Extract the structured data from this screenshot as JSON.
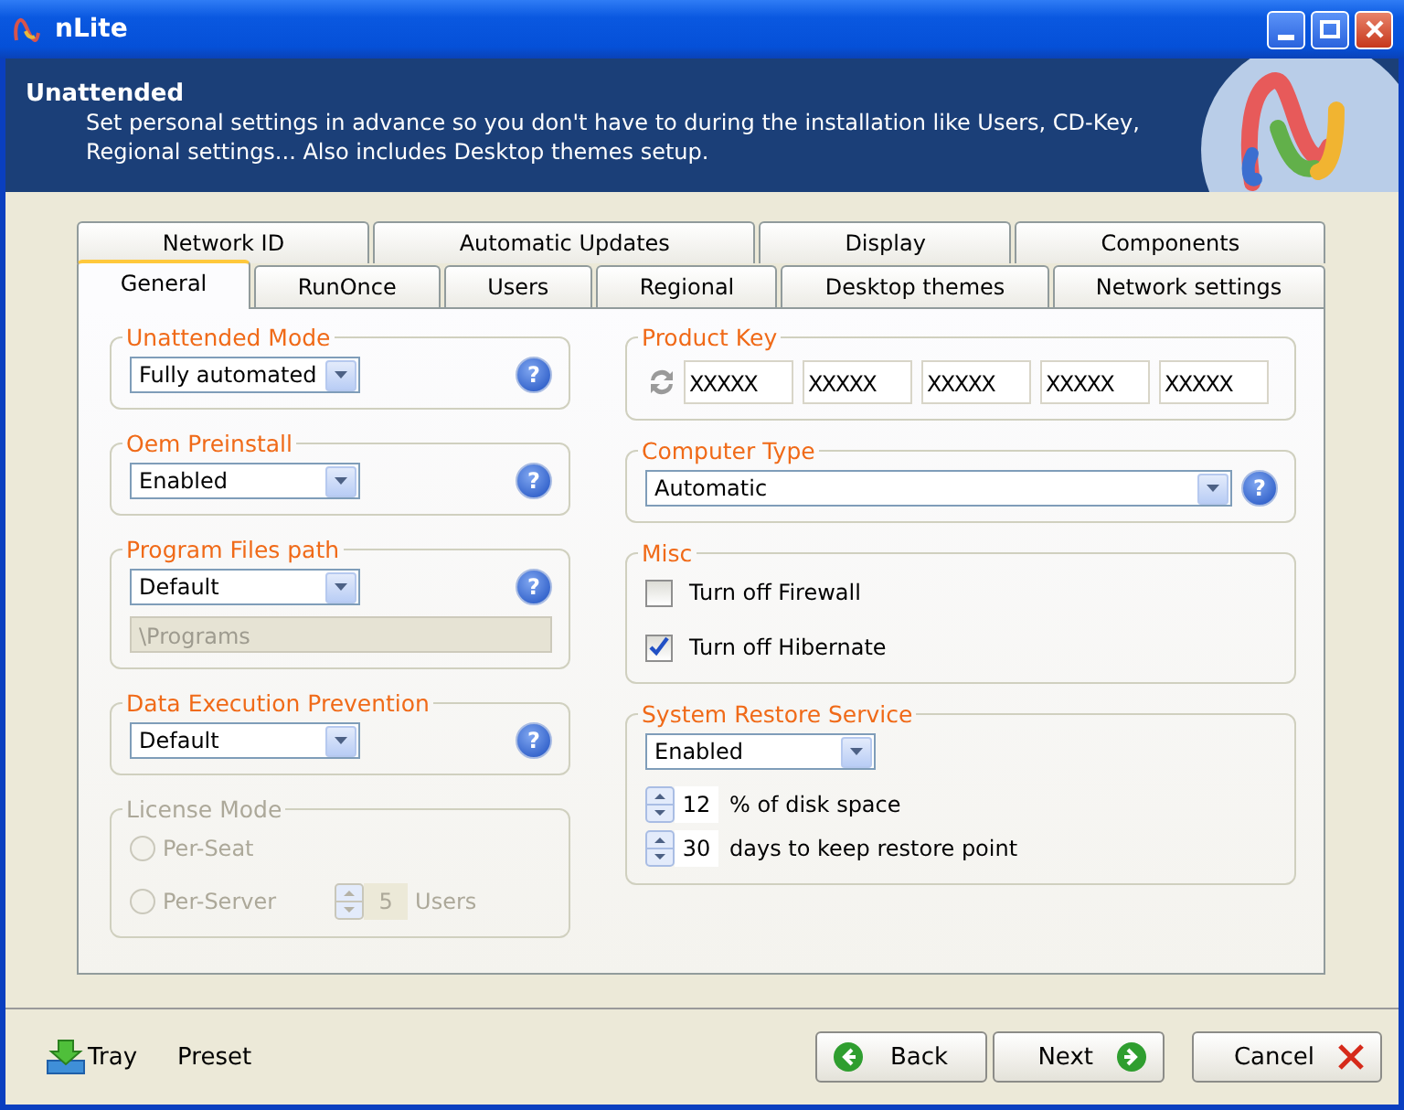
{
  "window": {
    "title": "nLite"
  },
  "header": {
    "title": "Unattended",
    "description_lines": [
      "Set personal settings in advance so you don't have to during the installation like Users, CD-Key,",
      "Regional settings... Also includes Desktop themes setup."
    ]
  },
  "tab_rows": [
    [
      {
        "label": "Network ID",
        "selected": false
      },
      {
        "label": "Automatic Updates",
        "selected": false
      },
      {
        "label": "Display",
        "selected": false
      },
      {
        "label": "Components",
        "selected": false
      }
    ],
    [
      {
        "label": "General",
        "selected": true
      },
      {
        "label": "RunOnce",
        "selected": false
      },
      {
        "label": "Users",
        "selected": false
      },
      {
        "label": "Regional",
        "selected": false
      },
      {
        "label": "Desktop themes",
        "selected": false
      },
      {
        "label": "Network settings",
        "selected": false
      }
    ]
  ],
  "left_groups": [
    {
      "title": "Unattended Mode",
      "disabled": false,
      "items": [
        {
          "kind": "dropdown",
          "value": "Fully automated",
          "help": "?"
        }
      ]
    },
    {
      "title": "Oem Preinstall",
      "disabled": false,
      "items": [
        {
          "kind": "dropdown",
          "value": "Enabled",
          "help": "?"
        }
      ]
    },
    {
      "title": "Program Files path",
      "disabled": false,
      "items": [
        {
          "kind": "dropdown",
          "value": "Default",
          "help": "?"
        },
        {
          "kind": "text",
          "value": "\\Programs",
          "disabled": true
        }
      ]
    },
    {
      "title": "Data Execution Prevention",
      "disabled": false,
      "items": [
        {
          "kind": "dropdown",
          "value": "Default",
          "help": "?"
        }
      ]
    },
    {
      "title": "License Mode",
      "disabled": true,
      "items": [
        {
          "kind": "radio",
          "label": "Per-Seat",
          "selected": false
        },
        {
          "kind": "radio",
          "label": "Per-Server",
          "selected": false,
          "spinner": {
            "value": "5",
            "unit": "Users"
          }
        }
      ]
    }
  ],
  "right_groups": [
    {
      "title": "Product Key",
      "disabled": false,
      "items": [
        {
          "kind": "key",
          "fields": [
            "XXXXX",
            "XXXXX",
            "XXXXX",
            "XXXXX",
            "XXXXX"
          ]
        }
      ]
    },
    {
      "title": "Computer Type",
      "disabled": false,
      "items": [
        {
          "kind": "dropdown",
          "value": "Automatic",
          "help": "?",
          "wide": true
        }
      ]
    },
    {
      "title": "Misc",
      "disabled": false,
      "items": [
        {
          "kind": "checkbox",
          "label": "Turn off Firewall",
          "checked": false
        },
        {
          "kind": "checkbox",
          "label": "Turn off Hibernate",
          "checked": true
        }
      ]
    },
    {
      "title": "System Restore Service",
      "disabled": false,
      "items": [
        {
          "kind": "dropdown",
          "value": "Enabled",
          "wide": false
        },
        {
          "kind": "spin",
          "value": "12",
          "label": "% of disk space"
        },
        {
          "kind": "spin",
          "value": "30",
          "label": "days to keep restore point"
        }
      ]
    }
  ],
  "footer": {
    "tray": "Tray",
    "preset": "Preset",
    "buttons": [
      {
        "kind": "back",
        "label": "Back"
      },
      {
        "kind": "next",
        "label": "Next"
      },
      {
        "kind": "cancel",
        "label": "Cancel"
      }
    ]
  }
}
